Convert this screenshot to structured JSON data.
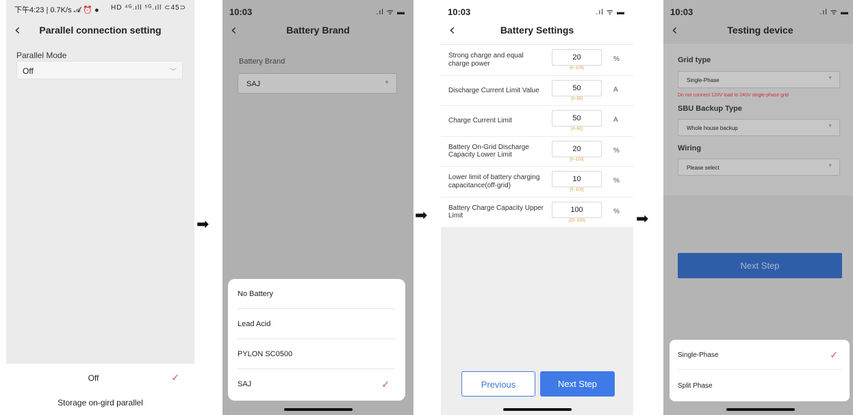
{
  "screen1": {
    "status_time": "下午4:23 | 0.7K/s 𝓐 ⏰ ●",
    "status_icons": "HD ⁴ᴳ.ıll ⁵ᴳ.ıll ⊂45⊃",
    "title": "Parallel connection setting",
    "field_label": "Parallel Mode",
    "field_value": "Off",
    "options": [
      "Off",
      "Storage on-gird parallel"
    ],
    "selected": "Off"
  },
  "screen2": {
    "status_time": "10:03",
    "status_icons": ".ıl ᯤ ▬",
    "title": "Battery Brand",
    "field_label": "Battery Brand",
    "field_value": "SAJ",
    "options": [
      "No Battery",
      "Lead Acid",
      "PYLON SC0500",
      "SAJ"
    ],
    "selected": "SAJ"
  },
  "screen3": {
    "status_time": "10:03",
    "status_icons": ".ıl ᯤ ▬",
    "title": "Battery Settings",
    "rows": [
      {
        "name": "Strong charge and equal charge power",
        "value": "20",
        "range": "[0~100]",
        "unit": "%"
      },
      {
        "name": "Discharge Current Limit Value",
        "value": "50",
        "range": "[0~50]",
        "unit": "A"
      },
      {
        "name": "Charge Current Limit",
        "value": "50",
        "range": "[0~50]",
        "unit": "A"
      },
      {
        "name": "Battery On-Grid Discharge Capacity Lower Limit",
        "value": "20",
        "range": "[0~100]",
        "unit": "%"
      },
      {
        "name": "Lower limit of battery charging capacitance(off-grid)",
        "value": "10",
        "range": "[5~100]",
        "unit": "%"
      },
      {
        "name": "Battery Charge Capacity Upper Limit",
        "value": "100",
        "range": "[20~100]",
        "unit": "%"
      }
    ],
    "prev_label": "Previous",
    "next_label": "Next Step"
  },
  "screen4": {
    "status_time": "10:03",
    "status_icons": ".ıl ᯤ ▬",
    "title": "Testing device",
    "grid_type_label": "Grid type",
    "grid_type_value": "Single-Phase",
    "warning": "Do not connect 120V load to 240V single-phase grid",
    "sbu_label": "SBU Backup Type",
    "sbu_value": "Whole house backup",
    "wiring_label": "Wiring",
    "wiring_placeholder": "Please select",
    "next_label": "Next Step",
    "options": [
      "Single-Phase",
      "Split Phase"
    ],
    "selected": "Single-Phase"
  },
  "arrow_glyph": "➡"
}
